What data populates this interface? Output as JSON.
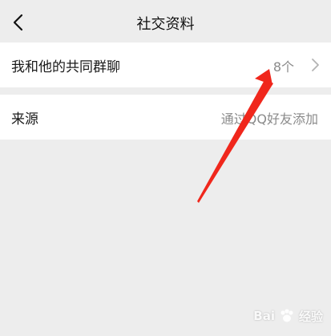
{
  "header": {
    "title": "社交资料"
  },
  "rows": [
    {
      "label": "我和他的共同群聊",
      "value": "8个"
    },
    {
      "label": "来源",
      "value": "通过QQ好友添加"
    }
  ],
  "icons": {
    "back": "chevron-left-icon",
    "row_chevron": "chevron-right-icon",
    "annotation": "red-arrow"
  },
  "colors": {
    "background": "#ededed",
    "row_background": "#ffffff",
    "value_text": "#8a8a8a",
    "annotation_arrow": "#f0271c"
  },
  "watermark": {
    "brand": "Bai",
    "suffix": "经验"
  }
}
